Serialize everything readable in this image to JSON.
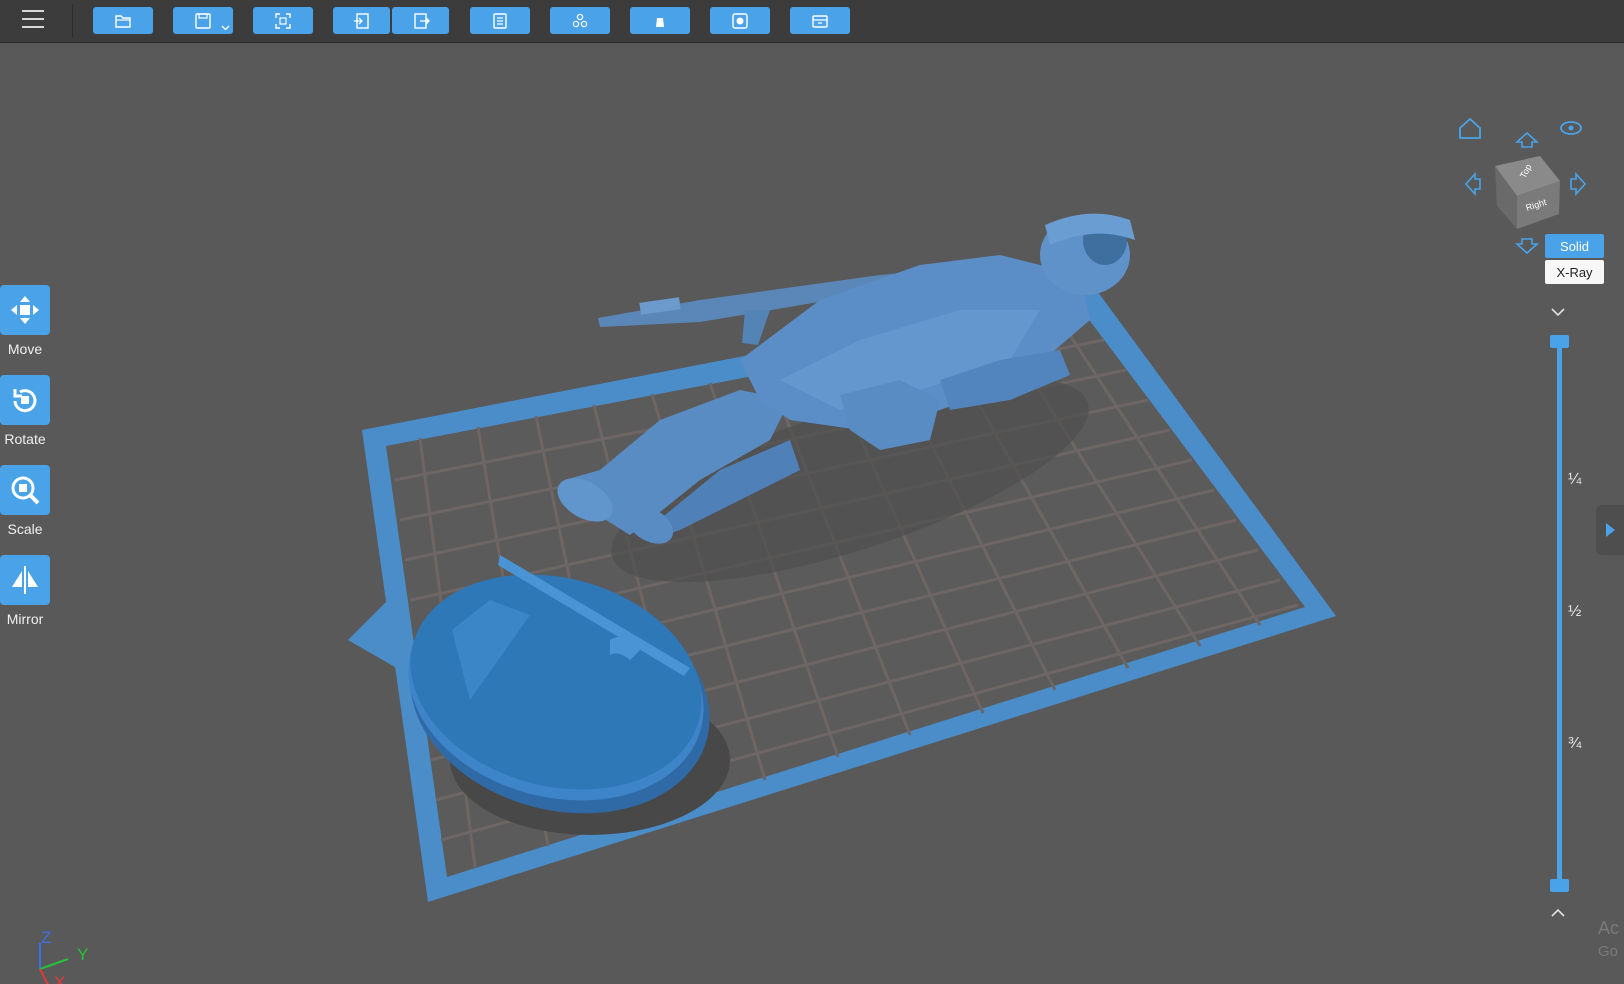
{
  "toolbar": {
    "menu_icon": "hamburger-icon",
    "buttons": [
      {
        "name": "open-file-button",
        "icon": "folder-icon"
      },
      {
        "name": "save-button",
        "icon": "save-icon",
        "has_dropdown": true
      },
      {
        "name": "fit-view-button",
        "icon": "fit-view-icon"
      },
      {
        "name": "import-button",
        "icon": "import-icon"
      },
      {
        "name": "export-button",
        "icon": "export-icon"
      },
      {
        "name": "layers-button",
        "icon": "list-icon"
      },
      {
        "name": "arrange-button",
        "icon": "arrange-icon"
      },
      {
        "name": "support-button",
        "icon": "support-icon"
      },
      {
        "name": "hollow-button",
        "icon": "hollow-icon"
      },
      {
        "name": "slice-button",
        "icon": "printer-icon"
      }
    ]
  },
  "left_tools": [
    {
      "label": "Move",
      "icon": "move-icon"
    },
    {
      "label": "Rotate",
      "icon": "rotate-icon"
    },
    {
      "label": "Scale",
      "icon": "scale-icon"
    },
    {
      "label": "Mirror",
      "icon": "mirror-icon"
    }
  ],
  "view_cube": {
    "top_label": "Top",
    "right_label": "Right",
    "home_icon": "home-icon",
    "eye_icon": "eye-icon"
  },
  "render_modes": {
    "solid": "Solid",
    "xray": "X-Ray",
    "active": "Solid"
  },
  "layer_slider": {
    "fractions": [
      "¼",
      "½",
      "¾"
    ]
  },
  "axes": {
    "z": "Z",
    "y": "Y",
    "x": "X"
  },
  "watermark": {
    "line1": "Ac",
    "line2": "Go"
  },
  "colors": {
    "accent": "#4aa3e8",
    "model": "#4f88c2",
    "plate": "#4a8dc8",
    "background": "#595959"
  }
}
